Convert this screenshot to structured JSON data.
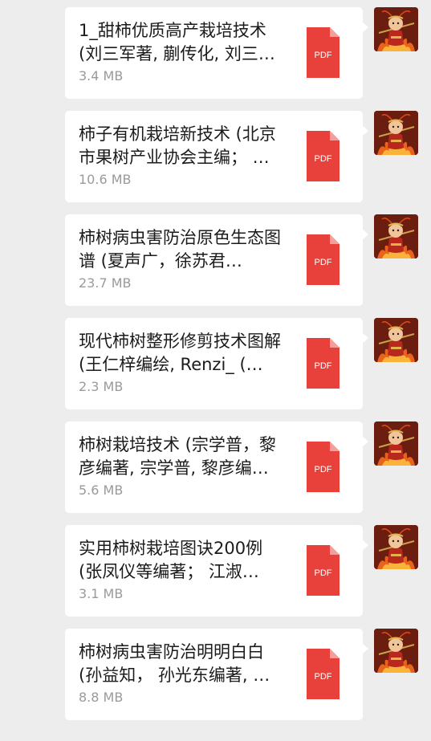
{
  "messages": [
    {
      "title": "1_甜柿优质高产栽培技术 (刘三军著, 蒯传化, 刘三…",
      "size": "3.4 MB",
      "file_type": "PDF",
      "icon": "pdf-file-icon"
    },
    {
      "title": "柿子有机栽培新技术 (北京市果树产业协会主编； …",
      "size": "10.6 MB",
      "file_type": "PDF",
      "icon": "pdf-file-icon"
    },
    {
      "title": "柿树病虫害防治原色生态图谱 (夏声广，徐苏君…",
      "size": "23.7 MB",
      "file_type": "PDF",
      "icon": "pdf-file-icon"
    },
    {
      "title": "现代柿树整形修剪技术图解 (王仁梓编绘, Renzi_ (…",
      "size": "2.3 MB",
      "file_type": "PDF",
      "icon": "pdf-file-icon"
    },
    {
      "title": "柿树栽培技术 (宗学普，黎彦编著, 宗学普, 黎彦编…",
      "size": "5.6 MB",
      "file_type": "PDF",
      "icon": "pdf-file-icon"
    },
    {
      "title": "实用柿树栽培图诀200例 (张凤仪等编著； 江淑…",
      "size": "3.1 MB",
      "file_type": "PDF",
      "icon": "pdf-file-icon"
    },
    {
      "title": "柿树病虫害防治明明白白 (孙益知， 孙光东编著, …",
      "size": "8.8 MB",
      "file_type": "PDF",
      "icon": "pdf-file-icon"
    }
  ],
  "colors": {
    "background": "#ededed",
    "bubble": "#ffffff",
    "pdf_red": "#e8413c",
    "pdf_fold": "#f3a09c",
    "title_text": "#1b1b1b",
    "size_text": "#9a9a9a"
  },
  "avatar": {
    "icon": "monkey-king-avatar-icon"
  }
}
